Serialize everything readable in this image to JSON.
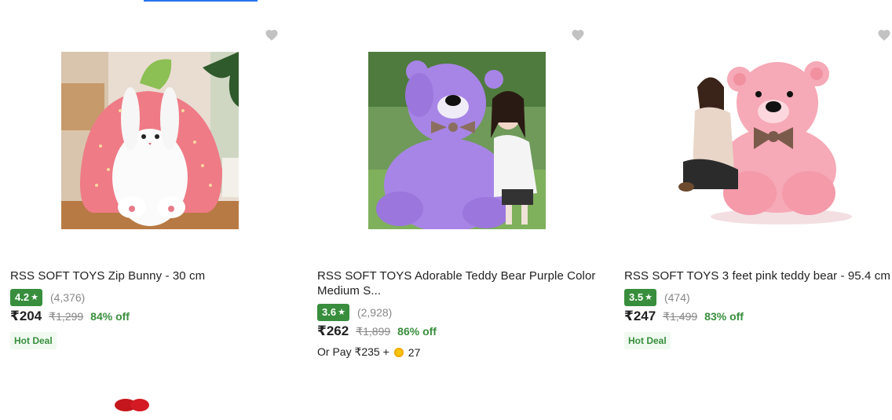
{
  "products": [
    {
      "title": "RSS SOFT TOYS Zip Bunny - 30 cm",
      "rating": "4.2",
      "ratings_count": "(4,376)",
      "price": "₹204",
      "mrp": "₹1,299",
      "discount": "84% off",
      "tag": "Hot Deal",
      "image": "pink strawberry bunny plush"
    },
    {
      "title": "RSS SOFT TOYS Adorable Teddy Bear Purple Color Medium S...",
      "rating": "3.6",
      "ratings_count": "(2,928)",
      "price": "₹262",
      "mrp": "₹1,899",
      "discount": "86% off",
      "or_pay": "Or Pay ₹235 +",
      "coins": "27",
      "image": "purple teddy bear with girl"
    },
    {
      "title": "RSS SOFT TOYS 3 feet pink teddy bear - 95.4 cm",
      "rating": "3.5",
      "ratings_count": "(474)",
      "price": "₹247",
      "mrp": "₹1,499",
      "discount": "83% off",
      "tag": "Hot Deal",
      "image": "pink teddy bear with woman"
    }
  ],
  "colors": {
    "rating_green": "#388e3c",
    "muted": "#878787",
    "accent_blue": "#2874f0"
  },
  "icons": {
    "wishlist": "heart-icon",
    "rating": "star-icon",
    "supercoin": "coin-icon"
  }
}
